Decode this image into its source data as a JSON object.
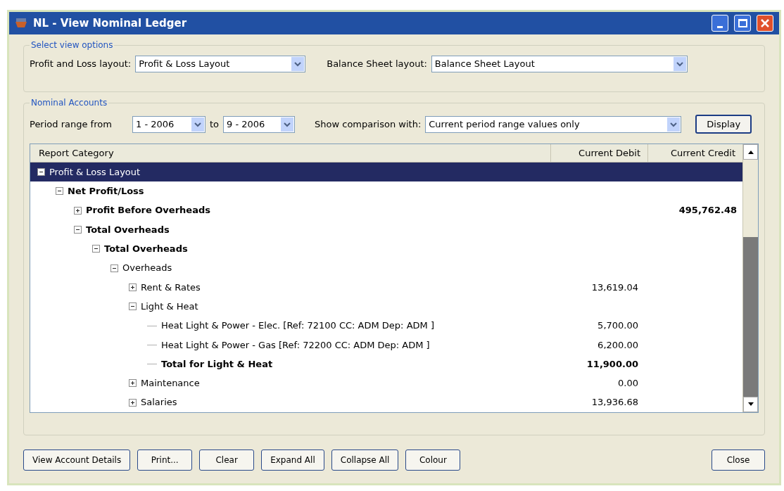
{
  "window": {
    "title": "NL - View Nominal Ledger"
  },
  "view_options": {
    "legend": "Select view options",
    "pl_label": "Profit and Loss layout:",
    "pl_value": "Profit & Loss Layout",
    "bs_label": "Balance Sheet layout:",
    "bs_value": "Balance Sheet Layout"
  },
  "nominal_accounts": {
    "legend": "Nominal Accounts",
    "period_label": "Period range from",
    "period_from": "1  - 2006",
    "to_label": "to",
    "period_to": "9  - 2006",
    "comparison_label": "Show comparison with:",
    "comparison_value": "Current period range values only",
    "display_button": "Display"
  },
  "table": {
    "columns": [
      "Report Category",
      "Current Debit",
      "Current Credit"
    ],
    "rows": [
      {
        "label": "Profit & Loss Layout",
        "bold": false,
        "selected": true,
        "expanded": true,
        "children": [
          {
            "label": "Net Profit/Loss",
            "bold": true,
            "selected": false,
            "expanded": true,
            "children": [
              {
                "label": "Profit Before Overheads",
                "credit": "495,762.48",
                "bold": true,
                "selected": false,
                "expanded": false
              },
              {
                "label": "Total Overheads",
                "bold": true,
                "selected": false,
                "expanded": true,
                "children": [
                  {
                    "label": "Total Overheads",
                    "bold": true,
                    "selected": false,
                    "expanded": true,
                    "children": [
                      {
                        "label": "Overheads",
                        "bold": false,
                        "selected": false,
                        "expanded": true,
                        "children": [
                          {
                            "label": "Rent & Rates",
                            "debit": "13,619.04",
                            "bold": false,
                            "selected": false,
                            "expanded": false
                          },
                          {
                            "label": "Light & Heat",
                            "bold": false,
                            "selected": false,
                            "expanded": true,
                            "children": [
                              {
                                "label": "Heat Light & Power - Elec. [Ref: 72100 CC: ADM Dep: ADM ]",
                                "debit": "5,700.00",
                                "bold": false,
                                "selected": false
                              },
                              {
                                "label": "Heat Light & Power - Gas [Ref: 72200 CC: ADM Dep: ADM ]",
                                "debit": "6,200.00",
                                "bold": false,
                                "selected": false
                              },
                              {
                                "label": "Total for Light & Heat",
                                "debit": "11,900.00",
                                "bold": true,
                                "selected": false
                              }
                            ]
                          },
                          {
                            "label": "Maintenance",
                            "debit": "0.00",
                            "bold": false,
                            "selected": false,
                            "expanded": false
                          },
                          {
                            "label": "Salaries",
                            "debit": "13,936.68",
                            "bold": false,
                            "selected": false,
                            "expanded": false
                          }
                        ]
                      }
                    ]
                  }
                ]
              }
            ]
          }
        ]
      }
    ]
  },
  "buttons": [
    "View Account Details",
    "Print...",
    "Clear",
    "Expand All",
    "Collapse All",
    "Colour"
  ],
  "close_button": "Close"
}
